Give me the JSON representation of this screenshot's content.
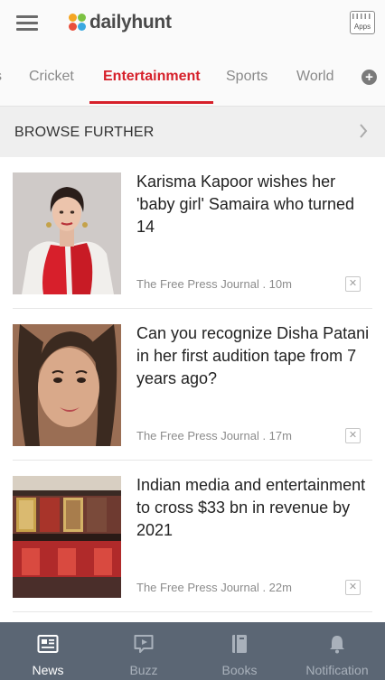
{
  "header": {
    "logo_text": "dailyhunt",
    "apps_label": "Apps"
  },
  "tabs": {
    "partial_left": "s",
    "items": [
      {
        "label": "Cricket"
      },
      {
        "label": "Entertainment",
        "active": true
      },
      {
        "label": "Sports"
      },
      {
        "label": "World"
      }
    ],
    "add_icon": "plus-circle-icon"
  },
  "browse": {
    "label": "BROWSE FURTHER",
    "icon": "chevron-right-icon"
  },
  "feed": [
    {
      "headline": "Karisma Kapoor wishes her 'baby girl' Samaira who turned 14",
      "source": "The Free Press Journal . 10m"
    },
    {
      "headline": "Can you recognize Disha Patani in her first audition tape from 7 years ago?",
      "source": "The Free Press Journal . 17m"
    },
    {
      "headline": "Indian media and entertainment to cross $33 bn in revenue by 2021",
      "source": "The Free Press Journal . 22m"
    }
  ],
  "bottom_nav": [
    {
      "label": "News",
      "icon": "newspaper-icon",
      "active": true
    },
    {
      "label": "Buzz",
      "icon": "play-bubble-icon"
    },
    {
      "label": "Books",
      "icon": "book-icon"
    },
    {
      "label": "Notification",
      "icon": "bell-icon"
    }
  ],
  "colors": {
    "accent": "#d6202a",
    "bottom_nav_bg": "#5b6674",
    "browse_bg": "#efefef"
  }
}
